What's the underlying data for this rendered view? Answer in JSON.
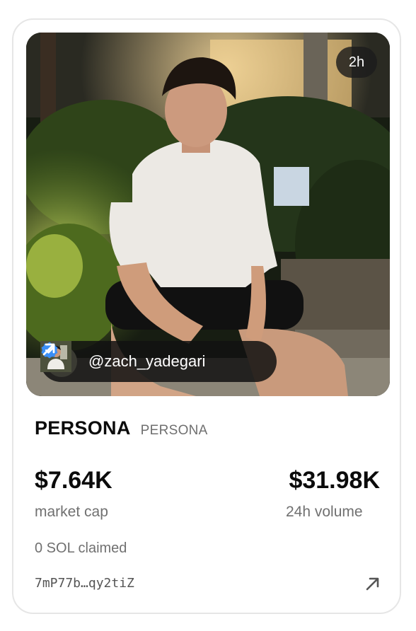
{
  "card": {
    "age_badge": "2h",
    "creator": {
      "handle": "@zach_yadegari",
      "avatar_icon": "creator-avatar",
      "verified_icon": "verified-badge-icon",
      "link_icon": "external-link-arrow-icon"
    },
    "token": {
      "name": "PERSONA",
      "symbol": "PERSONA"
    },
    "stats": {
      "market_cap_value": "$7.64K",
      "market_cap_label": "market cap",
      "volume_value": "$31.98K",
      "volume_label": "24h volume"
    },
    "claimed": "0 SOL claimed",
    "address": "7mP77b…qy2tiZ",
    "address_link_icon": "arrow-up-right-icon"
  },
  "colors": {
    "verified_blue": "#3a8ef6",
    "muted_text": "#707070",
    "pill_bg": "#121212",
    "card_border": "#e6e6e6"
  }
}
